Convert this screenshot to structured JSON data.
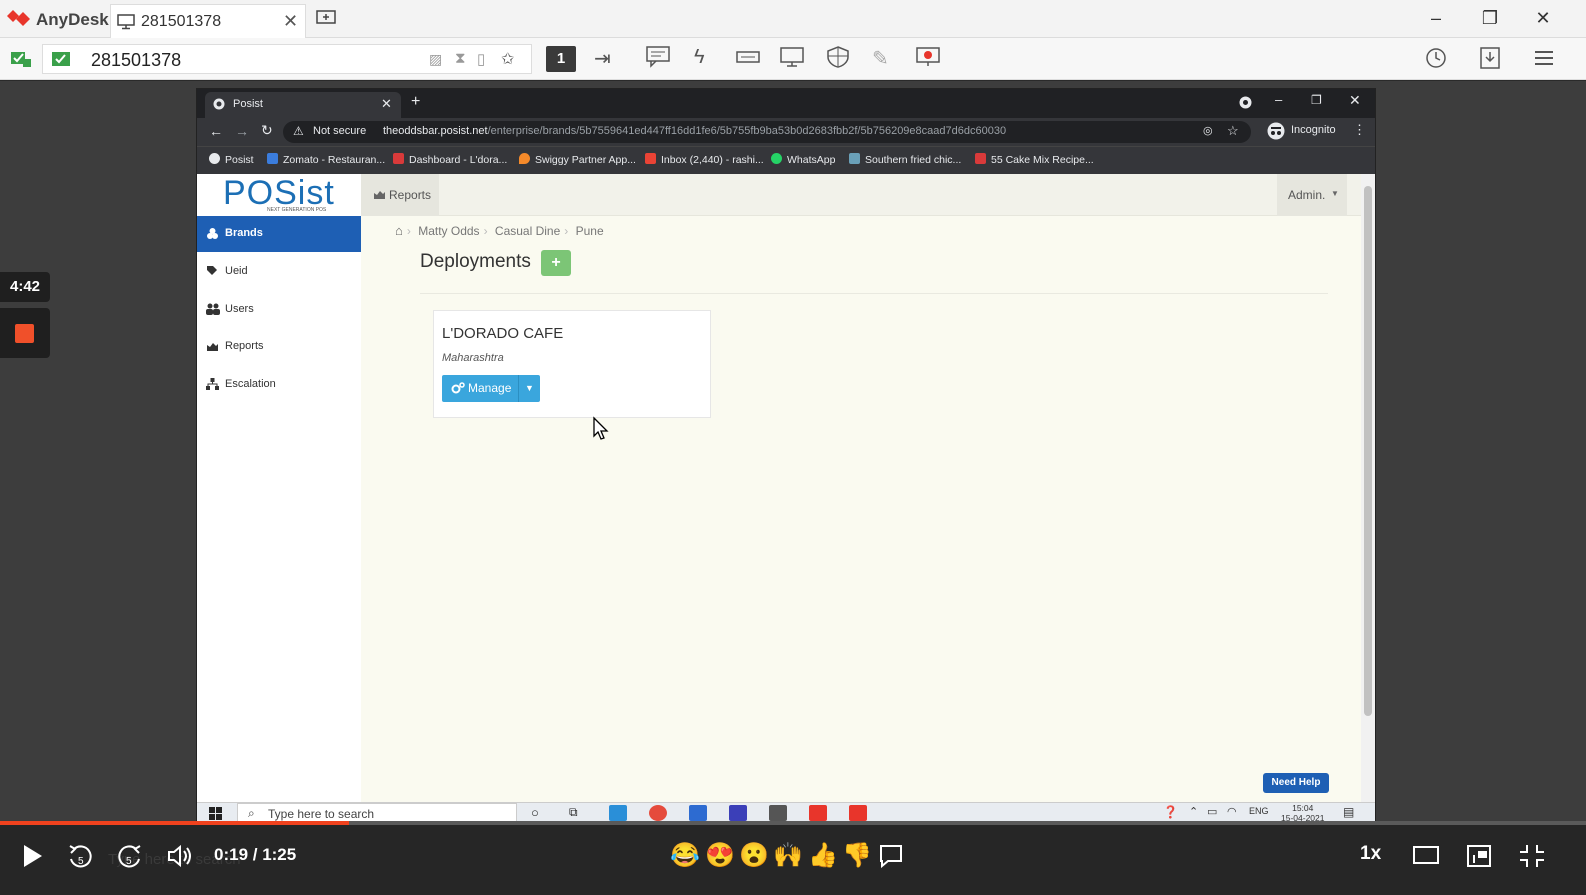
{
  "anydesk": {
    "app_name": "AnyDesk",
    "tab_label": "281501378",
    "address": "281501378",
    "monitor_number": "1"
  },
  "session": {
    "timer": "4:42"
  },
  "chrome": {
    "tab_title": "Posist",
    "not_secure": "Not secure",
    "url_host": "theoddsbar.posist.net",
    "url_path": "/enterprise/brands/5b7559641ed447ff16dd1fe6/5b755fb9ba53b0d2683fbb2f/5b756209e8caad7d6dc60030",
    "profile": "Incognito",
    "bookmarks": [
      "Posist",
      "Zomato - Restauran...",
      "Dashboard - L'dora...",
      "Swiggy Partner App...",
      "Inbox (2,440) - rashi...",
      "WhatsApp",
      "Southern fried chic...",
      "55 Cake Mix Recipe..."
    ]
  },
  "posist": {
    "logo": "POSist",
    "logo_sub": "NEXT GENERATION POS",
    "top_reports": "Reports",
    "admin": "Admin.",
    "sidebar": [
      "Brands",
      "Ueid",
      "Users",
      "Reports",
      "Escalation"
    ],
    "breadcrumb": [
      "Matty Odds",
      "Casual Dine",
      "Pune"
    ],
    "page_title": "Deployments",
    "card": {
      "title": "L'DORADO CAFE",
      "state": "Maharashtra",
      "button": "Manage"
    },
    "need_help": "Need Help"
  },
  "windows_taskbar": {
    "search_placeholder": "Type here to search",
    "lang": "ENG",
    "time": "15:04",
    "date": "15-04-2021"
  },
  "video_player": {
    "time": "0:19 / 1:25",
    "progress": 0.22,
    "speed": "1x",
    "ghost_search": "Type here to search",
    "reactions": [
      "😂",
      "😍",
      "😮",
      "🙌",
      "👍",
      "👎"
    ],
    "accent": "#f0421e"
  }
}
